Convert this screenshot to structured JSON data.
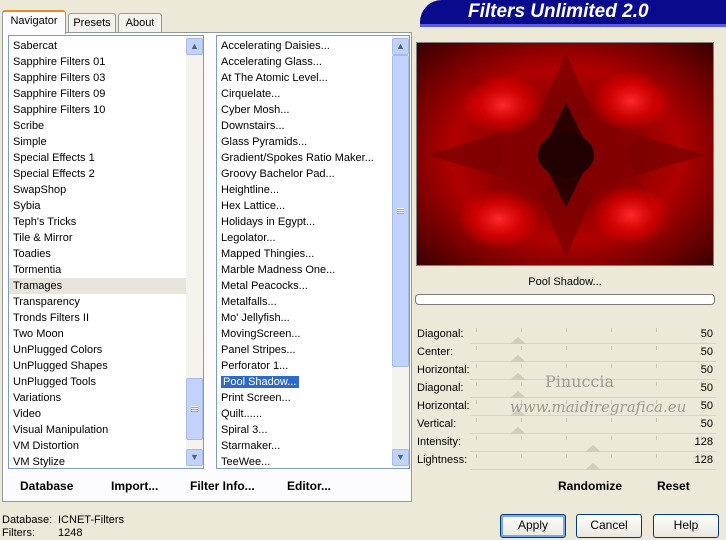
{
  "tabs": {
    "navigator": "Navigator",
    "presets": "Presets",
    "about": "About"
  },
  "banner_title": "Filters Unlimited 2.0",
  "categories": [
    "Sabercat",
    "Sapphire Filters 01",
    "Sapphire Filters 03",
    "Sapphire Filters 09",
    "Sapphire Filters 10",
    "Scribe",
    "Simple",
    "Special Effects 1",
    "Special Effects 2",
    "SwapShop",
    "Sybia",
    "Teph's Tricks",
    "Tile & Mirror",
    "Toadies",
    "Tormentia",
    "Tramages",
    "Transparency",
    "Tronds Filters II",
    "Two Moon",
    "UnPlugged Colors",
    "UnPlugged Shapes",
    "UnPlugged Tools",
    "Variations",
    "Video",
    "Visual Manipulation",
    "VM Distortion",
    "VM Stylize"
  ],
  "selected_category": "Tramages",
  "filters": [
    "Accelerating Daisies...",
    "Accelerating Glass...",
    "At The Atomic Level...",
    "Cirquelate...",
    "Cyber Mosh...",
    "Downstairs...",
    "Glass Pyramids...",
    "Gradient/Spokes Ratio Maker...",
    "Groovy Bachelor Pad...",
    "Heightline...",
    "Hex Lattice...",
    "Holidays in Egypt...",
    "Legolator...",
    "Mapped Thingies...",
    "Marble Madness One...",
    "Metal Peacocks...",
    "Metalfalls...",
    "Mo' Jellyfish...",
    "MovingScreen...",
    "Panel Stripes...",
    "Perforator 1...",
    "Pool Shadow...",
    "Print Screen...",
    "Quilt......",
    "Spiral 3...",
    "Starmaker...",
    "TeeWee..."
  ],
  "selected_filter": "Pool Shadow...",
  "bottom_links": {
    "database": "Database",
    "import": "Import...",
    "filter_info": "Filter Info...",
    "editor": "Editor..."
  },
  "preview_caption": "Pool Shadow...",
  "parameters": [
    {
      "label": "Diagonal:",
      "value": "50"
    },
    {
      "label": "Center:",
      "value": "50"
    },
    {
      "label": "Horizontal:",
      "value": "50"
    },
    {
      "label": "Diagonal:",
      "value": "50"
    },
    {
      "label": "Horizontal:",
      "value": "50"
    },
    {
      "label": "Vertical:",
      "value": "50"
    },
    {
      "label": "Intensity:",
      "value": "128"
    },
    {
      "label": "Lightness:",
      "value": "128"
    }
  ],
  "watermark": {
    "line1": "Pinuccia",
    "line2": "www.maidiregrafica.eu"
  },
  "actions": {
    "randomize": "Randomize",
    "reset": "Reset"
  },
  "status": {
    "database_label": "Database:",
    "database_value": "ICNET-Filters",
    "filters_label": "Filters:",
    "filters_value": "1248"
  },
  "buttons": {
    "apply": "Apply",
    "cancel": "Cancel",
    "help": "Help"
  },
  "colors": {
    "banner": "#0a0a8c",
    "selection": "#316ac5",
    "preview_red": "#e00000"
  }
}
